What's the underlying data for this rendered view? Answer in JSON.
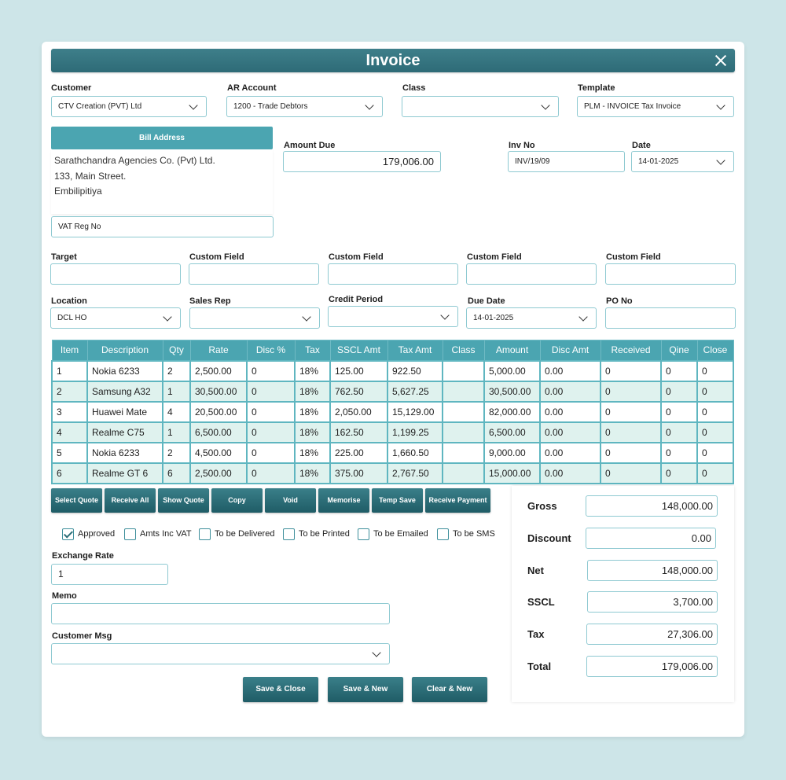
{
  "window": {
    "title": "Invoice"
  },
  "header": {
    "customer_label": "Customer",
    "customer_value": "CTV Creation (PVT) Ltd",
    "ar_label": "AR Account",
    "ar_value": "1200 - Trade Debtors",
    "class_label": "Class",
    "class_value": "",
    "template_label": "Template",
    "template_value": "PLM - INVOICE Tax Invoice"
  },
  "bill": {
    "title": "Bill Address",
    "line1": "Sarathchandra Agencies Co. (Pvt) Ltd.",
    "line2": "133, Main Street.",
    "line3": "Embilipitiya",
    "vat_value": "VAT Reg No"
  },
  "amount_due": {
    "label": "Amount Due",
    "value": "179,006.00"
  },
  "inv_no": {
    "label": "Inv No",
    "value": "INV/19/09"
  },
  "date": {
    "label": "Date",
    "value": "14-01-2025"
  },
  "custom": {
    "target_label": "Target",
    "cf1_label": "Custom Field",
    "cf2_label": "Custom Field",
    "cf3_label": "Custom Field",
    "cf4_label": "Custom Field"
  },
  "row3": {
    "location_label": "Location",
    "location_value": "DCL HO",
    "sales_rep_label": "Sales Rep",
    "sales_rep_value": "",
    "credit_label": "Credit Period",
    "credit_value": "",
    "due_label": "Due Date",
    "due_value": "14-01-2025",
    "po_label": "PO No",
    "po_value": ""
  },
  "table": {
    "headers": [
      "Item",
      "Description",
      "Qty",
      "Rate",
      "Disc %",
      "Tax",
      "SSCL Amt",
      "Tax Amt",
      "Class",
      "Amount",
      "Disc Amt",
      "Received",
      "Qine",
      "Close"
    ],
    "rows": [
      [
        "1",
        "Nokia 6233",
        "2",
        "2,500.00",
        "0",
        "18%",
        "125.00",
        "922.50",
        "",
        "5,000.00",
        "0.00",
        "0",
        "0",
        "0"
      ],
      [
        "2",
        "Samsung A32",
        "1",
        "30,500.00",
        "0",
        "18%",
        "762.50",
        "5,627.25",
        "",
        "30,500.00",
        "0.00",
        "0",
        "0",
        "0"
      ],
      [
        "3",
        "Huawei Mate",
        "4",
        "20,500.00",
        "0",
        "18%",
        "2,050.00",
        "15,129.00",
        "",
        "82,000.00",
        "0.00",
        "0",
        "0",
        "0"
      ],
      [
        "4",
        "Realme C75",
        "1",
        "6,500.00",
        "0",
        "18%",
        "162.50",
        "1,199.25",
        "",
        "6,500.00",
        "0.00",
        "0",
        "0",
        "0"
      ],
      [
        "5",
        "Nokia 6233",
        "2",
        "4,500.00",
        "0",
        "18%",
        "225.00",
        "1,660.50",
        "",
        "9,000.00",
        "0.00",
        "0",
        "0",
        "0"
      ],
      [
        "6",
        "Realme GT 6",
        "6",
        "2,500.00",
        "0",
        "18%",
        "375.00",
        "2,767.50",
        "",
        "15,000.00",
        "0.00",
        "0",
        "0",
        "0"
      ]
    ]
  },
  "actions": {
    "select_quote": "Select Quote",
    "receive_all": "Receive All",
    "show_quote": "Show Quote",
    "copy": "Copy",
    "void": "Void",
    "memorise": "Memorise",
    "temp_save": "Temp Save",
    "receive_payment": "Receive Payment"
  },
  "checks": {
    "approved": "Approved",
    "approved_checked": true,
    "amts_inc_vat": "Amts Inc VAT",
    "to_be_delivered": "To be Delivered",
    "to_be_printed": "To be Printed",
    "to_be_emailed": "To be Emailed",
    "to_be_sms": "To be SMS"
  },
  "exchange": {
    "label": "Exchange Rate",
    "value": "1"
  },
  "memo": {
    "label": "Memo",
    "value": ""
  },
  "customer_msg": {
    "label": "Customer Msg",
    "value": ""
  },
  "totals": {
    "gross_label": "Gross",
    "gross": "148,000.00",
    "discount_label": "Discount",
    "discount": "0.00",
    "net_label": "Net",
    "net": "148,000.00",
    "sscl_label": "SSCL",
    "sscl": "3,700.00",
    "tax_label": "Tax",
    "tax": "27,306.00",
    "total_label": "Total",
    "total": "179,006.00"
  },
  "footer": {
    "save_close": "Save & Close",
    "save_new": "Save & New",
    "clear_new": "Clear & New"
  },
  "colors": {
    "accent": "#4ba5b1",
    "dark_button": "#2b6d77",
    "row_alt": "#dff2ee",
    "border": "#8ec9d1"
  }
}
